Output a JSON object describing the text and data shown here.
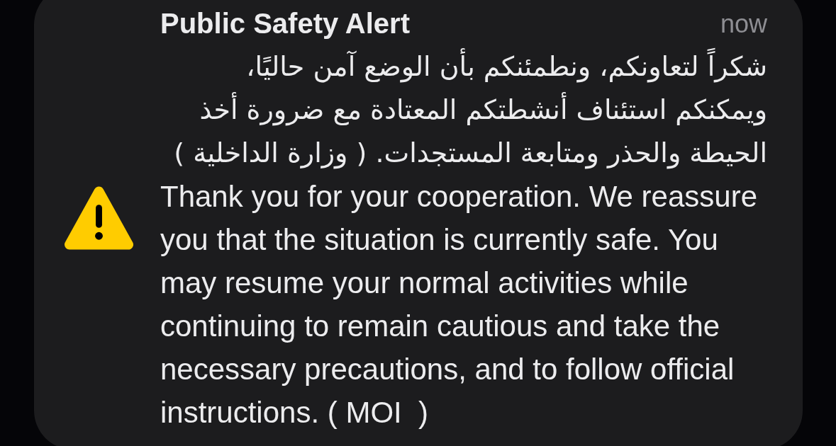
{
  "notification": {
    "title": "Public Safety Alert",
    "time": "now",
    "message_ar": "شكراً لتعاونكم، ونطمئنكم بأن الوضع آمن حاليًا، ويمكنكم استئناف أنشطتكم المعتادة مع ضرورة أخذ الحيطة والحذر ومتابعة المستجدات. ( وزارة الداخلية )",
    "message_en": "Thank you for your cooperation. We reassure you that the situation is currently safe. You may resume your normal activities while continuing to remain cautious and take the necessary precautions, and to follow official instructions. ( MOI  )"
  }
}
